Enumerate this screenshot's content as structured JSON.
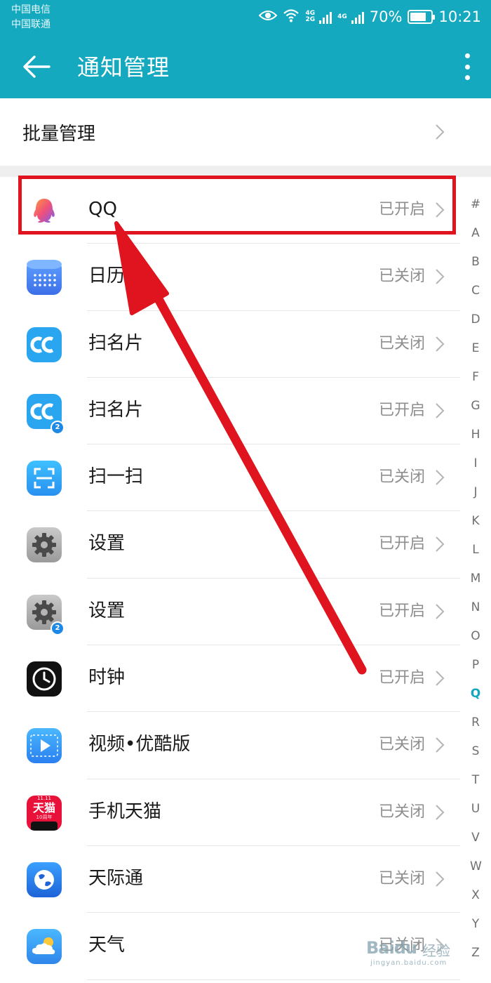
{
  "status_bar": {
    "carrier_1": "中国电信",
    "carrier_2": "中国联通",
    "net_1_top": "4G",
    "net_1_bottom": "2G",
    "net_2": "4G",
    "battery": "70%",
    "time": "10:21"
  },
  "app_bar": {
    "title": "通知管理",
    "back_icon": "arrow-left-icon",
    "more_icon": "more-vert-icon"
  },
  "batch": {
    "label": "批量管理"
  },
  "apps": [
    {
      "name": "QQ",
      "status": "已开启",
      "icon": "qq-icon",
      "twin": false
    },
    {
      "name": "日历",
      "status": "已关闭",
      "icon": "calendar-icon",
      "twin": false
    },
    {
      "name": "扫名片",
      "status": "已关闭",
      "icon": "card-scanner-icon",
      "twin": false
    },
    {
      "name": "扫名片",
      "status": "已开启",
      "icon": "card-scanner-icon",
      "twin": true,
      "twin_badge": "2"
    },
    {
      "name": "扫一扫",
      "status": "已关闭",
      "icon": "scan-icon",
      "twin": false
    },
    {
      "name": "设置",
      "status": "已开启",
      "icon": "settings-gear-icon",
      "twin": false
    },
    {
      "name": "设置",
      "status": "已开启",
      "icon": "settings-gear-icon",
      "twin": true,
      "twin_badge": "2"
    },
    {
      "name": "时钟",
      "status": "已开启",
      "icon": "clock-icon",
      "twin": false
    },
    {
      "name": "视频•优酷版",
      "status": "已关闭",
      "icon": "video-play-icon",
      "twin": false
    },
    {
      "name": "手机天猫",
      "status": "已关闭",
      "icon": "tmall-icon",
      "twin": false,
      "icon_text_top": "11.11",
      "icon_text": "天猫",
      "icon_text_bottom": "10周年"
    },
    {
      "name": "天际通",
      "status": "已关闭",
      "icon": "globe-icon",
      "twin": false
    },
    {
      "name": "天气",
      "status": "已关闭",
      "icon": "weather-icon",
      "twin": false
    }
  ],
  "alphabet_index": [
    "#",
    "A",
    "B",
    "C",
    "D",
    "E",
    "F",
    "G",
    "H",
    "I",
    "J",
    "K",
    "L",
    "M",
    "N",
    "O",
    "P",
    "Q",
    "R",
    "S",
    "T",
    "U",
    "V",
    "W",
    "X",
    "Y",
    "Z"
  ],
  "alphabet_active": "Q",
  "watermark": {
    "logo": "Baidu",
    "label": "经验",
    "url": "jingyan.baidu.com"
  },
  "colors": {
    "app_bar": "#14a9bf",
    "accent": "#12a7bd",
    "annotation_red": "#e0141e",
    "status_text": "#8e8e8e"
  }
}
